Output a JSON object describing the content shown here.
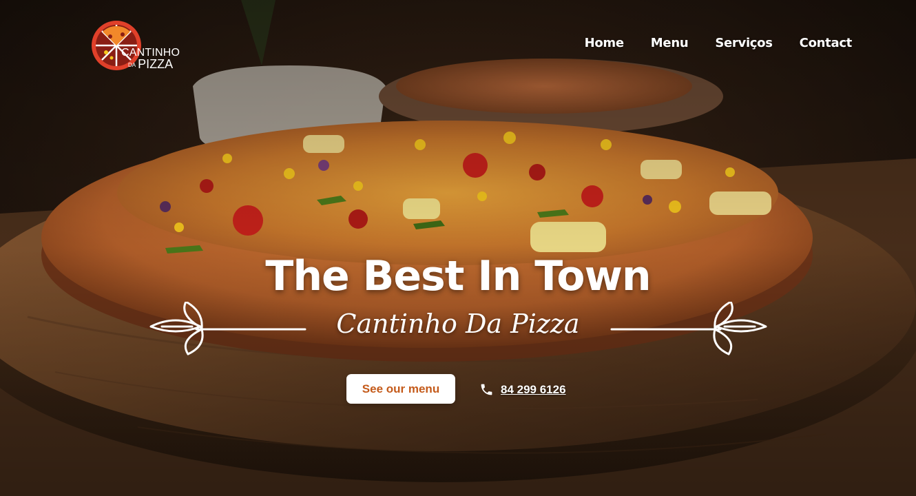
{
  "brand": {
    "line1": "CANTINHO",
    "da": "DA",
    "line2": "PIZZA",
    "logo_icon": "pizza-logo-icon",
    "logo_colors": {
      "ring": "#e0402a",
      "slice": "#f2882a",
      "inner": "#8a1e14"
    }
  },
  "nav": {
    "home": "Home",
    "menu": "Menu",
    "services": "Serviços",
    "contact": "Contact"
  },
  "hero": {
    "headline": "The Best In Town",
    "subtitle": "Cantinho Da Pizza",
    "cta_label": "See our menu",
    "phone_icon": "phone-icon",
    "phone": "84 299 6126",
    "decor_icon": "leaf-sprig-icon"
  },
  "colors": {
    "cta_text": "#c45a1a",
    "cta_bg": "#ffffff",
    "text": "#ffffff"
  }
}
